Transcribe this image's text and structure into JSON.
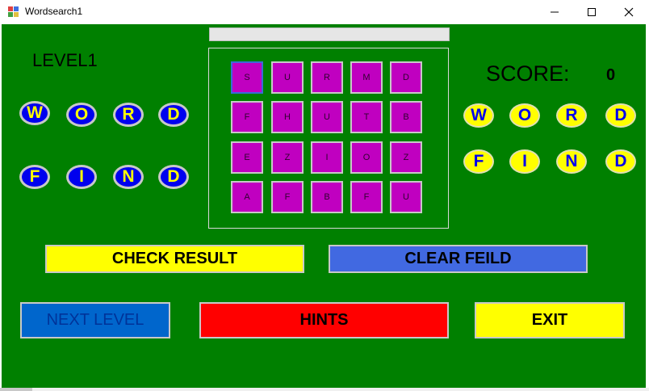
{
  "window": {
    "title": "Wordsearch1",
    "controls": {
      "minimize": "minimize-icon",
      "maximize": "maximize-icon",
      "close": "close-icon"
    }
  },
  "game": {
    "level_label": "LEVEL1",
    "score_label": "SCORE:",
    "score_value": "0",
    "progress": 0,
    "left_words": {
      "row1": [
        "W",
        "O",
        "R",
        "D"
      ],
      "row2": [
        "F",
        "I",
        "N",
        "D"
      ]
    },
    "right_words": {
      "row1": [
        "W",
        "O",
        "R",
        "D"
      ],
      "row2": [
        "F",
        "I",
        "N",
        "D"
      ]
    },
    "grid": [
      [
        "S",
        "U",
        "R",
        "M",
        "D"
      ],
      [
        "F",
        "H",
        "U",
        "T",
        "B"
      ],
      [
        "E",
        "Z",
        "I",
        "O",
        "Z"
      ],
      [
        "A",
        "F",
        "B",
        "F",
        "U"
      ]
    ]
  },
  "buttons": {
    "check": "CHECK RESULT",
    "clear": "CLEAR FEILD",
    "next": "NEXT LEVEL",
    "hints": "HINTS",
    "exit": "EXIT"
  },
  "colors": {
    "background": "#008000",
    "cell": "#c000c0",
    "chip_blue": "#0000ee",
    "chip_yellow": "#ffff00"
  }
}
